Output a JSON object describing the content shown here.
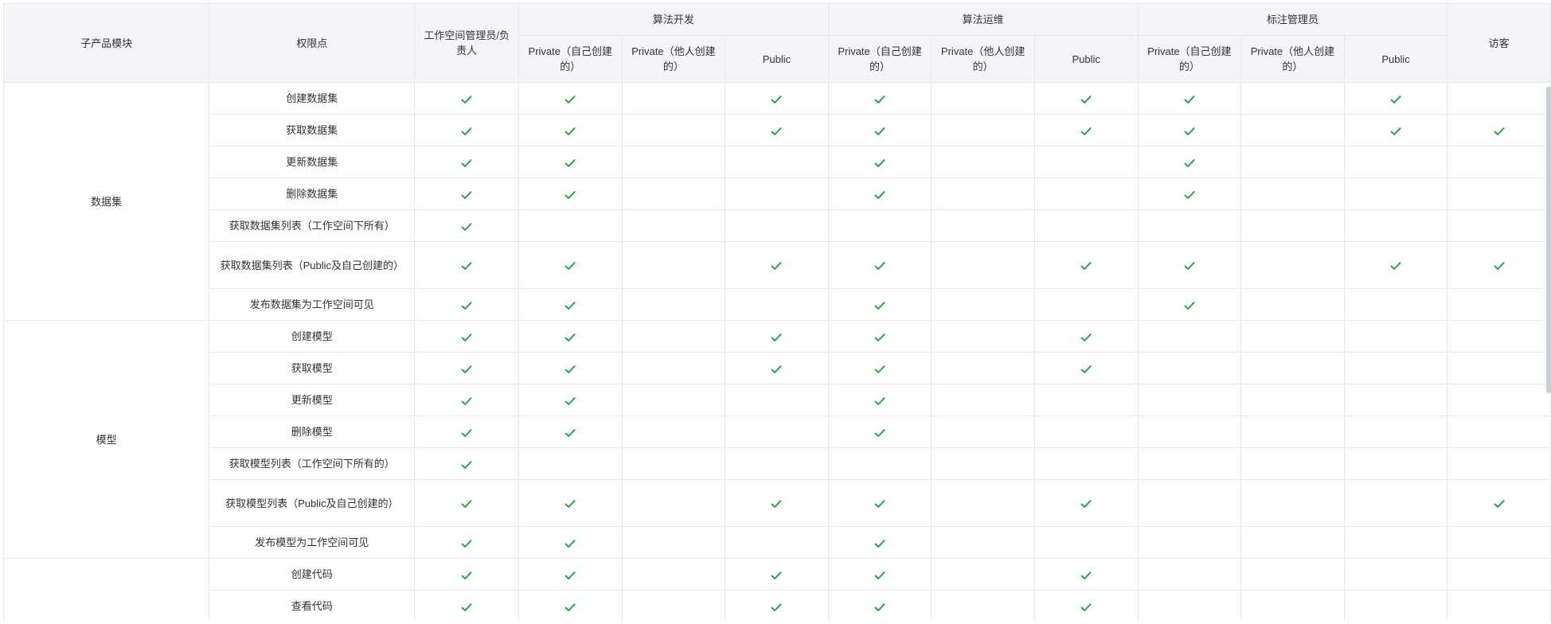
{
  "header": {
    "module": "子产品模块",
    "permission": "权限点",
    "admin": "工作空间管理员/负责人",
    "groups": [
      "算法开发",
      "算法运维",
      "标注管理员"
    ],
    "sub": [
      "Private（自己创建的）",
      "Private（他人创建的）",
      "Public"
    ],
    "visitor": "访客"
  },
  "check_color": "#2ba24c",
  "sections": [
    {
      "module": "数据集",
      "rows": [
        {
          "label": "创建数据集",
          "checks": [
            1,
            1,
            0,
            1,
            1,
            0,
            1,
            1,
            0,
            1,
            0
          ]
        },
        {
          "label": "获取数据集",
          "checks": [
            1,
            1,
            0,
            1,
            1,
            0,
            1,
            1,
            0,
            1,
            1
          ]
        },
        {
          "label": "更新数据集",
          "checks": [
            1,
            1,
            0,
            0,
            1,
            0,
            0,
            1,
            0,
            0,
            0
          ]
        },
        {
          "label": "删除数据集",
          "checks": [
            1,
            1,
            0,
            0,
            1,
            0,
            0,
            1,
            0,
            0,
            0
          ]
        },
        {
          "label": "获取数据集列表（工作空间下所有）",
          "checks": [
            1,
            0,
            0,
            0,
            0,
            0,
            0,
            0,
            0,
            0,
            0
          ]
        },
        {
          "label": "获取数据集列表（Public及自己创建的）",
          "checks": [
            1,
            1,
            0,
            1,
            1,
            0,
            1,
            1,
            0,
            1,
            1
          ],
          "tall": true
        },
        {
          "label": "发布数据集为工作空间可见",
          "checks": [
            1,
            1,
            0,
            0,
            1,
            0,
            0,
            1,
            0,
            0,
            0
          ]
        }
      ]
    },
    {
      "module": "模型",
      "rows": [
        {
          "label": "创建模型",
          "checks": [
            1,
            1,
            0,
            1,
            1,
            0,
            1,
            0,
            0,
            0,
            0
          ]
        },
        {
          "label": "获取模型",
          "checks": [
            1,
            1,
            0,
            1,
            1,
            0,
            1,
            0,
            0,
            0,
            0
          ]
        },
        {
          "label": "更新模型",
          "checks": [
            1,
            1,
            0,
            0,
            1,
            0,
            0,
            0,
            0,
            0,
            0
          ]
        },
        {
          "label": "删除模型",
          "checks": [
            1,
            1,
            0,
            0,
            1,
            0,
            0,
            0,
            0,
            0,
            0
          ]
        },
        {
          "label": "获取模型列表（工作空间下所有的）",
          "checks": [
            1,
            0,
            0,
            0,
            0,
            0,
            0,
            0,
            0,
            0,
            0
          ]
        },
        {
          "label": "获取模型列表（Public及自己创建的）",
          "checks": [
            1,
            1,
            0,
            1,
            1,
            0,
            1,
            0,
            0,
            0,
            1
          ],
          "tall": true
        },
        {
          "label": "发布模型为工作空间可见",
          "checks": [
            1,
            1,
            0,
            0,
            1,
            0,
            0,
            0,
            0,
            0,
            0
          ]
        }
      ]
    },
    {
      "module": "",
      "rows": [
        {
          "label": "创建代码",
          "checks": [
            1,
            1,
            0,
            1,
            1,
            0,
            1,
            0,
            0,
            0,
            0
          ]
        },
        {
          "label": "查看代码",
          "checks": [
            1,
            1,
            0,
            1,
            1,
            0,
            1,
            0,
            0,
            0,
            0
          ]
        }
      ]
    }
  ]
}
